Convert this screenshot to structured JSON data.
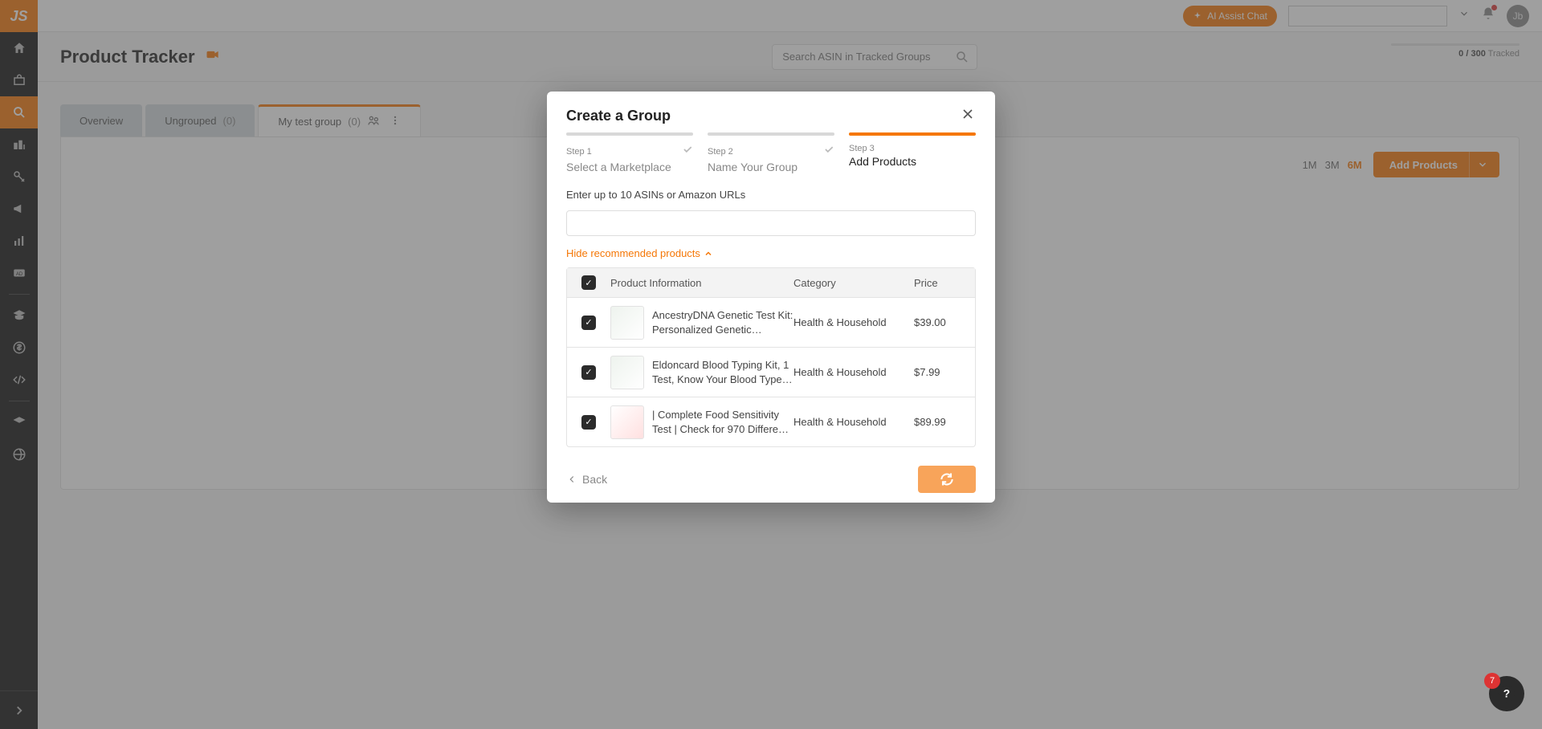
{
  "brand": "JS",
  "topbar": {
    "ai_chat": "AI Assist Chat",
    "avatar": "Jb"
  },
  "page": {
    "title": "Product Tracker",
    "search_placeholder": "Search ASIN in Tracked Groups",
    "tracked_count": "0 / 300",
    "tracked_label": "Tracked"
  },
  "tabs": [
    {
      "label": "Overview",
      "count": ""
    },
    {
      "label": "Ungrouped",
      "count": "(0)"
    },
    {
      "label": "My test group",
      "count": "(0)"
    }
  ],
  "ranges": [
    "1M",
    "3M",
    "6M"
  ],
  "range_selected": "6M",
  "add_products_btn": "Add Products",
  "modal": {
    "title": "Create a Group",
    "steps": [
      {
        "num": "Step 1",
        "name": "Select a Marketplace"
      },
      {
        "num": "Step 2",
        "name": "Name Your Group"
      },
      {
        "num": "Step 3",
        "name": "Add Products"
      }
    ],
    "active_step_index": 2,
    "asin_label": "Enter up to 10 ASINs or Amazon URLs",
    "hide_recommended": "Hide recommended products",
    "table_headers": {
      "info": "Product Information",
      "category": "Category",
      "price": "Price"
    },
    "products": [
      {
        "name": "AncestryDNA Genetic Test Kit: Personalized Genetic…",
        "category": "Health & Household",
        "price": "$39.00"
      },
      {
        "name": "Eldoncard Blood Typing Kit, 1 Test, Know Your Blood Type…",
        "category": "Health & Household",
        "price": "$7.99"
      },
      {
        "name": "| Complete Food Sensitivity Test | Check for 970 Differe…",
        "category": "Health & Household",
        "price": "$89.99"
      }
    ],
    "back": "Back"
  },
  "help_badge": "7"
}
